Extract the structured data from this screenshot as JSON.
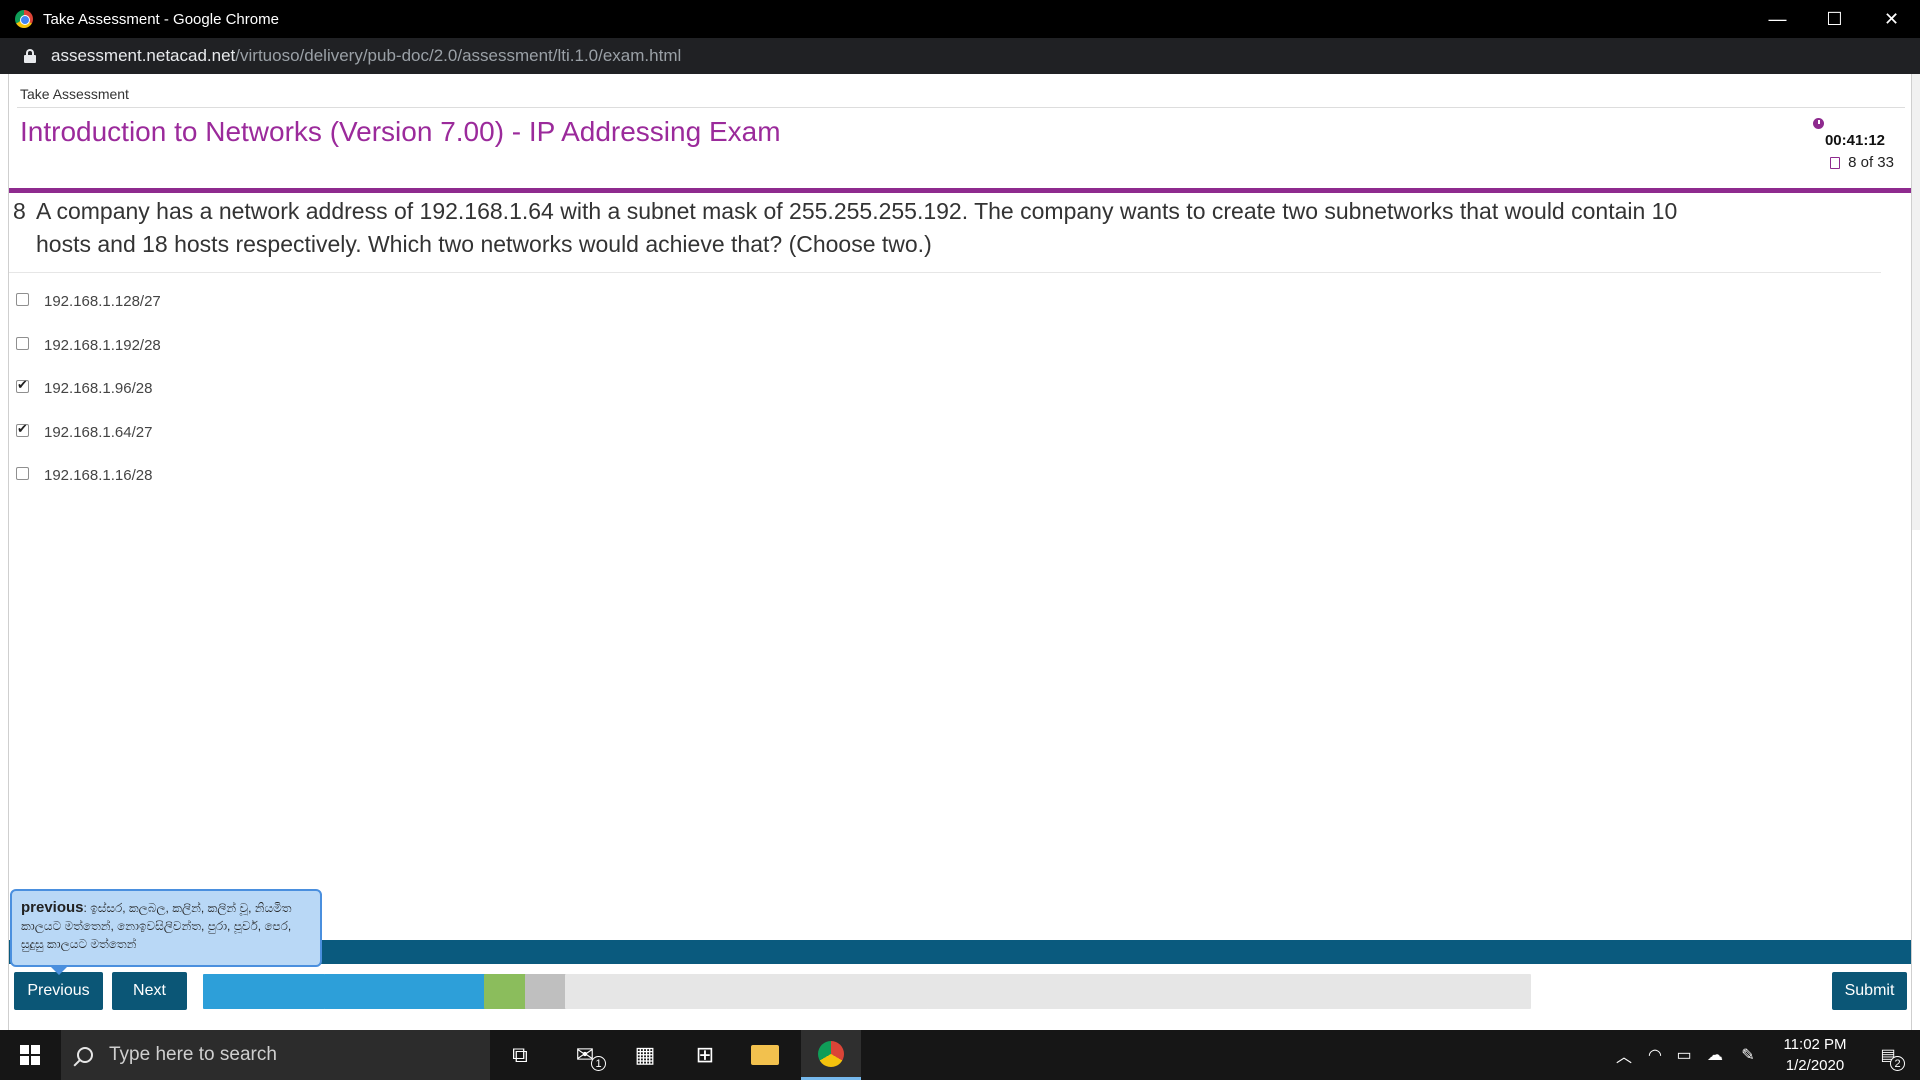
{
  "window": {
    "title": "Take Assessment - Google Chrome",
    "minimize": "—",
    "maximize": "☐",
    "close": "✕"
  },
  "address": {
    "host": "assessment.netacad.net",
    "path": "/virtuoso/delivery/pub-doc/2.0/assessment/lti.1.0/exam.html"
  },
  "page": {
    "breadcrumb": "Take Assessment",
    "exam_title": "Introduction to Networks (Version 7.00) - IP Addressing Exam",
    "timer": "00:41:12",
    "progress": "8 of 33"
  },
  "question": {
    "number": "8",
    "text": "A company has a network address of 192.168.1.64 with a subnet mask of 255.255.255.192. The company wants to create two subnetworks that would contain 10 hosts and 18 hosts respectively. Which two networks would achieve that? (Choose two.)",
    "options": [
      {
        "label": "192.168.1.128/27",
        "checked": false
      },
      {
        "label": "192.168.1.192/28",
        "checked": false
      },
      {
        "label": "192.168.1.96/28",
        "checked": true
      },
      {
        "label": "192.168.1.64/27",
        "checked": true
      },
      {
        "label": "192.168.1.16/28",
        "checked": false
      }
    ]
  },
  "navigation": {
    "previous": "Previous",
    "next": "Next",
    "submit": "Submit",
    "question_states": [
      "answered",
      "answered",
      "answered",
      "answered",
      "answered",
      "answered",
      "answered",
      "current",
      "flagged",
      "blank",
      "blank",
      "blank",
      "blank",
      "blank",
      "blank",
      "blank",
      "blank",
      "blank",
      "blank",
      "blank",
      "blank",
      "blank",
      "blank",
      "blank",
      "blank",
      "blank",
      "blank",
      "blank",
      "blank",
      "blank",
      "blank",
      "blank",
      "blank"
    ]
  },
  "tooltip": {
    "word": "previous",
    "definition": ": ඉස්සර, කලබල, කලින්, කලින් වූ, නියමිත කාලයට මත්තෙන්, නොඉවසිලිවන්ත, පුරා, පූර්ව, පෙර, සුදුසු කාලයට මත්තෙන්"
  },
  "taskbar": {
    "search_placeholder": "Type here to search",
    "mail_badge": "1",
    "time": "11:02 PM",
    "date": "1/2/2020",
    "notification_count": "2"
  },
  "colors": {
    "accent_purple": "#8e2a8e",
    "title_purple": "#9b2a9b",
    "nav_dark": "#0b5676",
    "answered_blue": "#2d9fd9",
    "current_green": "#8bbd5c"
  }
}
